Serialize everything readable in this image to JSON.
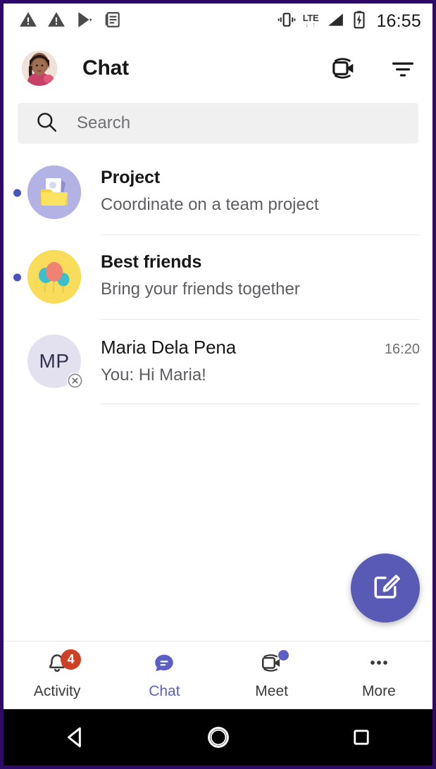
{
  "theme": {
    "accent": "#5b5fc7",
    "fab": "#585ab5",
    "badge_red": "#cc4125",
    "frame_purple": "#2d0a68",
    "search_bg": "#f0f0f0"
  },
  "status_bar": {
    "time": "16:55",
    "network_type": "LTE",
    "data_arrows": "↓ ↑",
    "left_icons": [
      "warning-triangle-icon",
      "warning-triangle-icon",
      "play-store-icon",
      "news-article-icon"
    ],
    "right_icons": [
      "vibrate-icon",
      "lte-signal-icon",
      "cellular-signal-icon",
      "battery-charging-icon"
    ]
  },
  "header": {
    "title": "Chat",
    "avatar_label": "profile-photo",
    "video_call_label": "meet-now",
    "filter_label": "filter"
  },
  "search": {
    "placeholder": "Search",
    "value": ""
  },
  "chats": [
    {
      "name": "Project",
      "preview": "Coordinate on a team project",
      "time": "",
      "unread": true,
      "avatar_type": "folder",
      "avatar_bg": "#b0b0e0",
      "initials": "",
      "bold_title": true,
      "presence": ""
    },
    {
      "name": "Best friends",
      "preview": "Bring your friends together",
      "time": "",
      "unread": true,
      "avatar_type": "balloons",
      "avatar_bg": "#f8da54",
      "initials": "",
      "bold_title": true,
      "presence": ""
    },
    {
      "name": "Maria Dela Pena",
      "preview": "You: Hi Maria!",
      "time": "16:20",
      "unread": false,
      "avatar_type": "initials",
      "avatar_bg": "#e3e1ef",
      "initials": "MP",
      "bold_title": false,
      "presence": "offline"
    }
  ],
  "fab": {
    "label": "New chat",
    "icon": "compose-icon"
  },
  "bottom_nav": {
    "items": [
      {
        "label": "Activity",
        "icon": "bell-icon",
        "badge": "4",
        "active": false,
        "dot": false
      },
      {
        "label": "Chat",
        "icon": "chat-bubble-icon",
        "badge": "",
        "active": true,
        "dot": false
      },
      {
        "label": "Meet",
        "icon": "video-camera-icon",
        "badge": "",
        "active": false,
        "dot": true
      },
      {
        "label": "More",
        "icon": "ellipsis-icon",
        "badge": "",
        "active": false,
        "dot": false
      }
    ]
  },
  "android_nav": {
    "back": "back-button",
    "home": "home-button",
    "recents": "recents-button"
  }
}
